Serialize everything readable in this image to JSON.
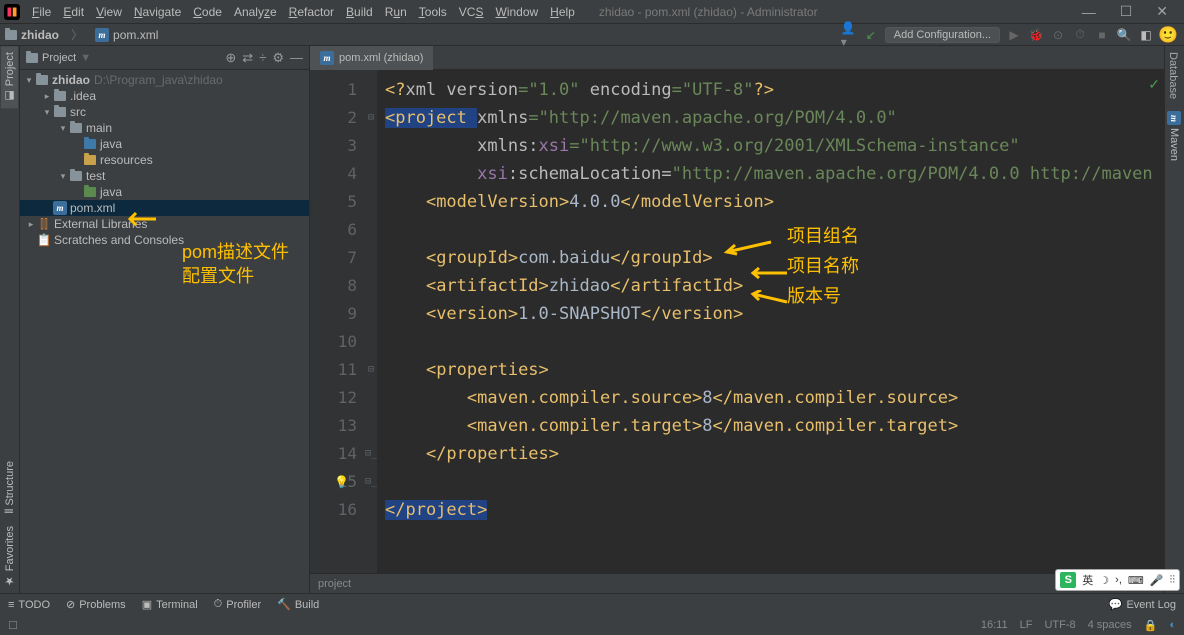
{
  "window": {
    "title": "zhidao - pom.xml (zhidao) - Administrator"
  },
  "menu": [
    "File",
    "Edit",
    "View",
    "Navigate",
    "Code",
    "Analyze",
    "Refactor",
    "Build",
    "Run",
    "Tools",
    "VCS",
    "Window",
    "Help"
  ],
  "breadcrumb": {
    "root": "zhidao",
    "file": "pom.xml"
  },
  "toolbar": {
    "add_config": "Add Configuration..."
  },
  "sidebar": {
    "title": "Project",
    "tree": {
      "root": {
        "name": "zhidao",
        "path": "D:\\Program_java\\zhidao"
      },
      "idea": ".idea",
      "src": "src",
      "main": "main",
      "java": "java",
      "resources": "resources",
      "test": "test",
      "java2": "java",
      "pom": "pom.xml",
      "ext": "External Libraries",
      "scratch": "Scratches and Consoles"
    }
  },
  "left_tabs": {
    "project": "Project",
    "structure": "Structure",
    "fav": "Favorites"
  },
  "right_tabs": {
    "maven": "Maven",
    "db": "Database"
  },
  "editor": {
    "tab": "pom.xml (zhidao)",
    "crumb": "project",
    "lines": [
      "1",
      "2",
      "3",
      "4",
      "5",
      "6",
      "7",
      "8",
      "9",
      "10",
      "11",
      "12",
      "13",
      "14",
      "15",
      "16"
    ],
    "code": {
      "l1a": "<?",
      "l1b": "xml version",
      "l1c": "=\"1.0\" ",
      "l1d": "encoding",
      "l1e": "=\"UTF-8\"",
      "l1f": "?>",
      "l2a": "<project ",
      "l2b": "xmlns",
      "l2c": "=",
      "l2d": "\"http://maven.apache.org/POM/4.0.0\"",
      "l3a": "xmlns:",
      "l3b": "xsi",
      "l3c": "=",
      "l3d": "\"http://www.w3.org/2001/XMLSchema-instance\"",
      "l4a": "xsi",
      "l4b": ":schemaLocation=",
      "l4c": "\"http://maven.apache.org/POM/4.0.0 http://maven",
      "l5a": "<modelVersion>",
      "l5b": "4.0.0",
      "l5c": "</modelVersion>",
      "l7a": "<groupId>",
      "l7b": "com.baidu",
      "l7c": "</groupId>",
      "l8a": "<artifactId>",
      "l8b": "zhidao",
      "l8c": "</artifactId>",
      "l9a": "<version>",
      "l9b": "1.0-SNAPSHOT",
      "l9c": "</version>",
      "l11a": "<properties>",
      "l12a": "<maven.compiler.source>",
      "l12b": "8",
      "l12c": "</maven.compiler.source>",
      "l13a": "<maven.compiler.target>",
      "l13b": "8",
      "l13c": "</maven.compiler.target>",
      "l14a": "</properties>",
      "l16a": "</project>"
    }
  },
  "bottom": {
    "todo": "TODO",
    "problems": "Problems",
    "terminal": "Terminal",
    "profiler": "Profiler",
    "build": "Build",
    "event": "Event Log"
  },
  "status": {
    "pos": "16:11",
    "le": "LF",
    "enc": "UTF-8",
    "indent": "4 spaces"
  },
  "annotations": {
    "a1": "pom描述文件",
    "a1b": "配置文件",
    "a2": "项目组名",
    "a3": "项目名称",
    "a4": "版本号"
  },
  "ime": {
    "lang": "英"
  }
}
